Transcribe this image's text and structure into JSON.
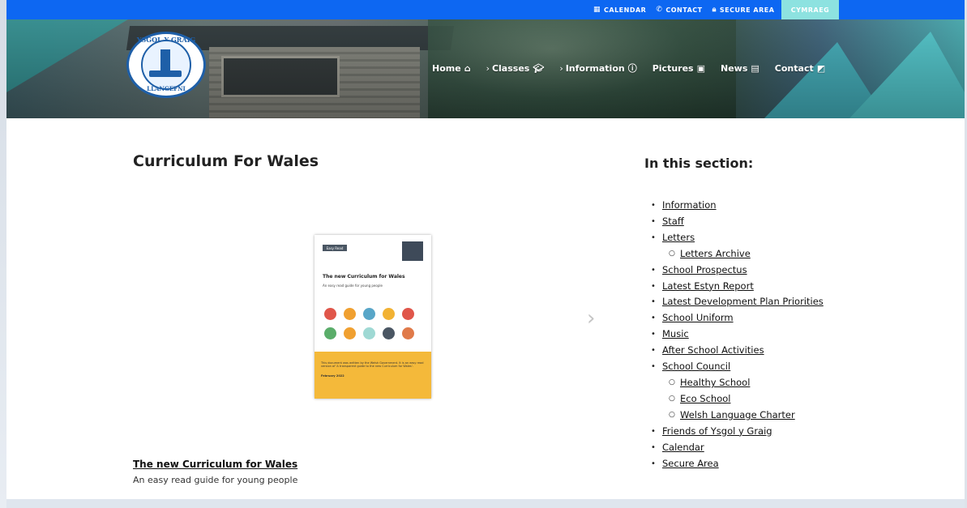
{
  "topbar": {
    "links": [
      {
        "icon": "calendar-icon",
        "glyph": "▦",
        "label": "CALENDAR"
      },
      {
        "icon": "phone-icon",
        "glyph": "✆",
        "label": "CONTACT"
      },
      {
        "icon": "lock-icon",
        "glyph": "🔒︎",
        "label": "SECURE AREA"
      }
    ],
    "language_button": "CYMRAEG",
    "accent_color": "#0d67f2",
    "language_color": "#8de2e0"
  },
  "logo": {
    "top_text": "YSGOL Y GRAIG",
    "bottom_text": "LLANGEFNI"
  },
  "nav": [
    {
      "label": "Home",
      "prefix": "",
      "icon": "home-icon",
      "glyph": "⌂"
    },
    {
      "label": "Classes",
      "prefix": "›",
      "icon": "graduation-cap-icon",
      "glyph": "🎓︎"
    },
    {
      "label": "Information",
      "prefix": "›",
      "icon": "info-icon",
      "glyph": "ⓘ"
    },
    {
      "label": "Pictures",
      "prefix": "",
      "icon": "image-icon",
      "glyph": "▣"
    },
    {
      "label": "News",
      "prefix": "",
      "icon": "newspaper-icon",
      "glyph": "▤"
    },
    {
      "label": "Contact",
      "prefix": "",
      "icon": "contact-icon",
      "glyph": "◩"
    }
  ],
  "main": {
    "title": "Curriculum For Wales",
    "document": {
      "badge": "Easy Read",
      "title": "The new Curriculum for Wales",
      "subtitle": "An easy read guide for young people",
      "footer_text": "This document was written by the Welsh Government. It is an easy read version of 'A transparent guide to the new Curriculum for Wales'.",
      "footer_date": "February 2022"
    },
    "next_arrow": "›",
    "caption_link": "The new Curriculum for Wales",
    "caption_sub": "An easy read guide for young people"
  },
  "sidebar": {
    "title": "In this section:",
    "items": [
      {
        "label": "Information",
        "level": 1
      },
      {
        "label": "Staff",
        "level": 1
      },
      {
        "label": "Letters",
        "level": 1
      },
      {
        "label": "Letters Archive",
        "level": 2
      },
      {
        "label": "School Prospectus",
        "level": 1
      },
      {
        "label": "Latest Estyn Report",
        "level": 1
      },
      {
        "label": "Latest Development Plan Priorities",
        "level": 1
      },
      {
        "label": "School Uniform",
        "level": 1
      },
      {
        "label": "Music",
        "level": 1
      },
      {
        "label": "After School Activities",
        "level": 1
      },
      {
        "label": "School Council",
        "level": 1
      },
      {
        "label": "Healthy School",
        "level": 2
      },
      {
        "label": "Eco School",
        "level": 2
      },
      {
        "label": "Welsh Language Charter",
        "level": 2
      },
      {
        "label": "Friends of Ysgol y Graig",
        "level": 1
      },
      {
        "label": "Calendar",
        "level": 1
      },
      {
        "label": "Secure Area",
        "level": 1
      }
    ]
  }
}
